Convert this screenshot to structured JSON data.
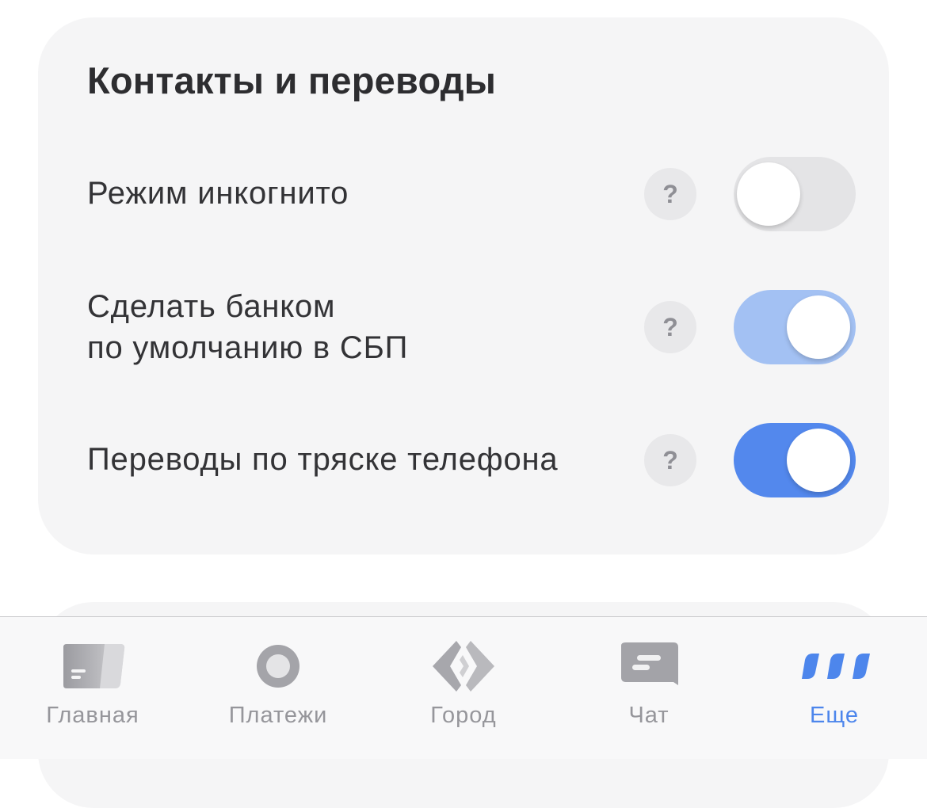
{
  "section": {
    "title": "Контакты и переводы",
    "help_glyph": "?",
    "rows": [
      {
        "label": "Режим инкогнито",
        "toggle": "off"
      },
      {
        "label": "Сделать банком\nпо умолчанию в СБП",
        "toggle": "on (dimmed)"
      },
      {
        "label": "Переводы по тряске телефона",
        "toggle": "on"
      }
    ]
  },
  "tabbar": {
    "active": "Еще",
    "tabs": [
      {
        "label": "Главная",
        "icon": "card-icon"
      },
      {
        "label": "Платежи",
        "icon": "circle-icon"
      },
      {
        "label": "Город",
        "icon": "diamond-logo-icon"
      },
      {
        "label": "Чат",
        "icon": "chat-bubble-icon"
      },
      {
        "label": "Еще",
        "icon": "more-dots-icon"
      }
    ]
  },
  "colors": {
    "accent": "#5388ED",
    "accent_dimmed": "#A3C1F3",
    "card_bg": "#F5F5F6",
    "inactive_tab": "#96969B"
  }
}
